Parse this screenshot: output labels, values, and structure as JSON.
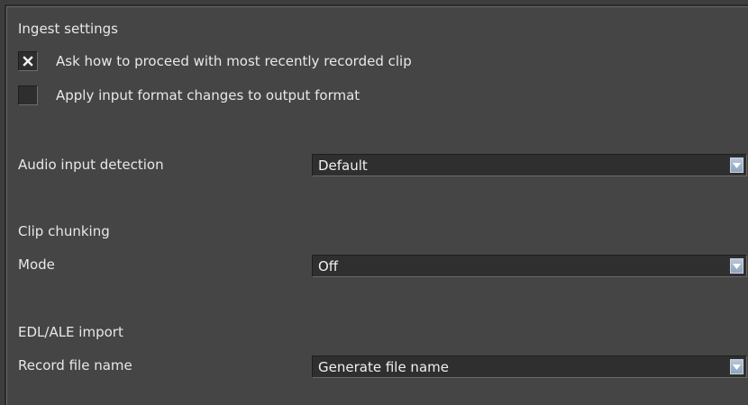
{
  "ingest": {
    "heading": "Ingest settings",
    "ask_proceed": {
      "label": "Ask how to proceed with most recently recorded clip",
      "checked": true
    },
    "apply_format": {
      "label": "Apply input format changes to output format",
      "checked": false
    }
  },
  "audio": {
    "label": "Audio input detection",
    "value": "Default"
  },
  "clip_chunking": {
    "heading": "Clip chunking",
    "mode_label": "Mode",
    "mode_value": "Off"
  },
  "edl_import": {
    "heading": "EDL/ALE import",
    "record_label": "Record file name",
    "record_value": "Generate file name"
  },
  "icons": {
    "check": "x-check-icon",
    "dropdown_arrow": "chevron-down-icon"
  },
  "colors": {
    "background": "#454545",
    "text": "#e8e8e8",
    "field": "#2f2f2f",
    "dropdown_button": "#9fb1c8"
  }
}
